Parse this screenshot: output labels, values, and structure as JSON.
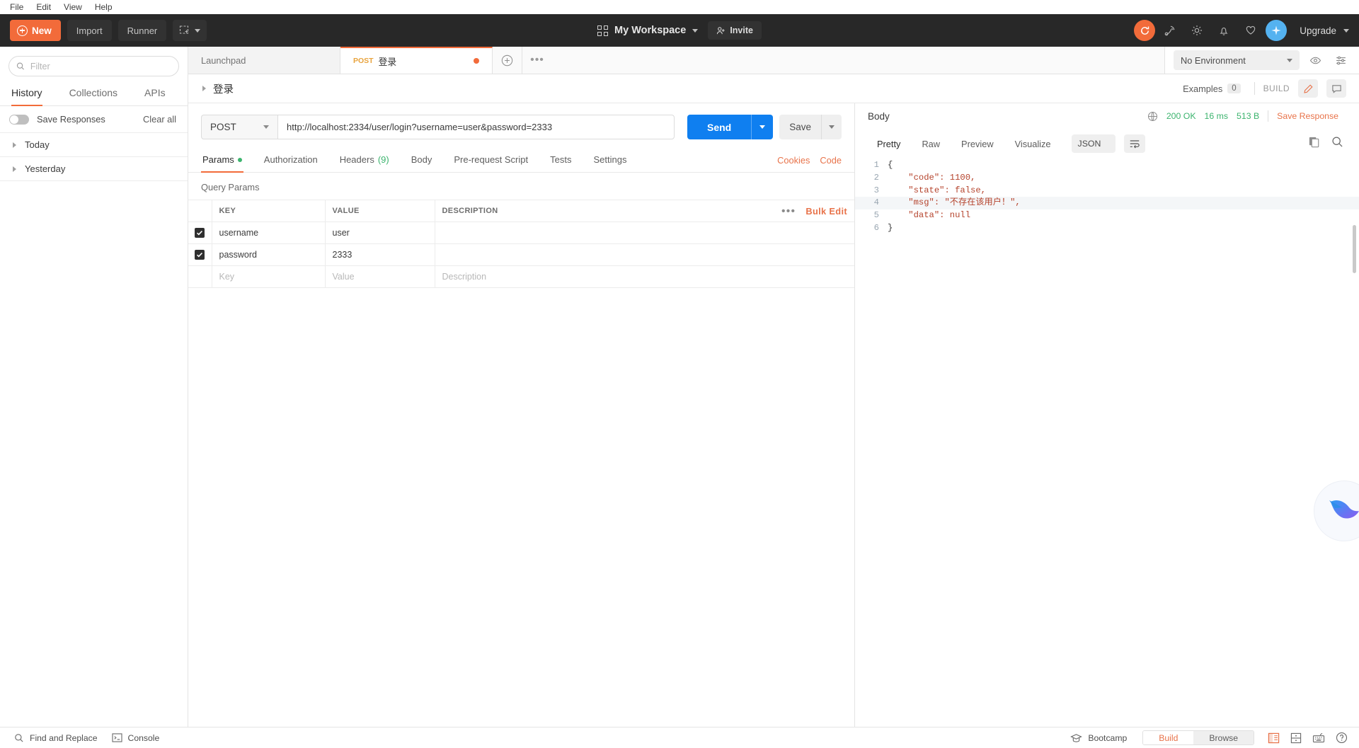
{
  "menubar": {
    "items": [
      "File",
      "Edit",
      "View",
      "Help"
    ]
  },
  "header": {
    "new_label": "New",
    "import_label": "Import",
    "runner_label": "Runner",
    "workspace_label": "My Workspace",
    "invite_label": "Invite",
    "upgrade_label": "Upgrade",
    "icons": [
      "sync-icon",
      "satellite-icon",
      "gear-icon",
      "bell-icon",
      "heart-icon",
      "sparkle-avatar-icon"
    ],
    "accent": "#f26b3a"
  },
  "sidebar": {
    "filter_placeholder": "Filter",
    "tabs": [
      {
        "label": "History",
        "active": true
      },
      {
        "label": "Collections",
        "active": false
      },
      {
        "label": "APIs",
        "active": false
      }
    ],
    "save_responses_label": "Save Responses",
    "save_responses_on": false,
    "clear_all_label": "Clear all",
    "groups": [
      {
        "label": "Today"
      },
      {
        "label": "Yesterday"
      }
    ]
  },
  "tabbar": {
    "tabs": [
      {
        "label": "Launchpad",
        "method": "",
        "active": false,
        "unsaved": false
      },
      {
        "label": "登录",
        "method": "POST",
        "active": true,
        "unsaved": true
      }
    ],
    "environment": "No Environment"
  },
  "breadcrumb": {
    "name": "登录",
    "examples_label": "Examples",
    "examples_count": "0",
    "build_label": "BUILD"
  },
  "request": {
    "method": "POST",
    "url": "http://localhost:2334/user/login?username=user&password=2333",
    "send_label": "Send",
    "save_label": "Save",
    "tabs": [
      {
        "label": "Params",
        "active": true,
        "dot": true,
        "count": ""
      },
      {
        "label": "Authorization",
        "active": false,
        "dot": false,
        "count": ""
      },
      {
        "label": "Headers",
        "active": false,
        "dot": false,
        "count": "(9)"
      },
      {
        "label": "Body",
        "active": false,
        "dot": false,
        "count": ""
      },
      {
        "label": "Pre-request Script",
        "active": false,
        "dot": false,
        "count": ""
      },
      {
        "label": "Tests",
        "active": false,
        "dot": false,
        "count": ""
      },
      {
        "label": "Settings",
        "active": false,
        "dot": false,
        "count": ""
      }
    ],
    "cookies_label": "Cookies",
    "code_label": "Code",
    "query_params_title": "Query Params",
    "bulk_edit_label": "Bulk Edit",
    "table": {
      "headers": [
        "KEY",
        "VALUE",
        "DESCRIPTION"
      ],
      "rows": [
        {
          "checked": true,
          "key": "username",
          "value": "user",
          "description": ""
        },
        {
          "checked": true,
          "key": "password",
          "value": "2333",
          "description": ""
        }
      ],
      "placeholder_row": {
        "key": "Key",
        "value": "Value",
        "description": "Description"
      }
    }
  },
  "response": {
    "body_label": "Body",
    "status": "200 OK",
    "time": "16 ms",
    "size": "513 B",
    "save_response_label": "Save Response",
    "view_tabs": [
      {
        "label": "Pretty",
        "active": true
      },
      {
        "label": "Raw",
        "active": false
      },
      {
        "label": "Preview",
        "active": false
      },
      {
        "label": "Visualize",
        "active": false
      }
    ],
    "format": "JSON",
    "lines": [
      {
        "n": "1",
        "text": "{",
        "hl": false
      },
      {
        "n": "2",
        "text": "    \"code\": 1100,",
        "hl": false
      },
      {
        "n": "3",
        "text": "    \"state\": false,",
        "hl": false
      },
      {
        "n": "4",
        "text": "    \"msg\": \"不存在该用户！\",",
        "hl": true
      },
      {
        "n": "5",
        "text": "    \"data\": null",
        "hl": false
      },
      {
        "n": "6",
        "text": "}",
        "hl": false
      }
    ],
    "json_body": {
      "code": 1100,
      "state": false,
      "msg": "不存在该用户！",
      "data": null
    }
  },
  "footer": {
    "find_replace_label": "Find and Replace",
    "console_label": "Console",
    "bootcamp_label": "Bootcamp",
    "build_label": "Build",
    "browse_label": "Browse",
    "mode": "Build"
  }
}
